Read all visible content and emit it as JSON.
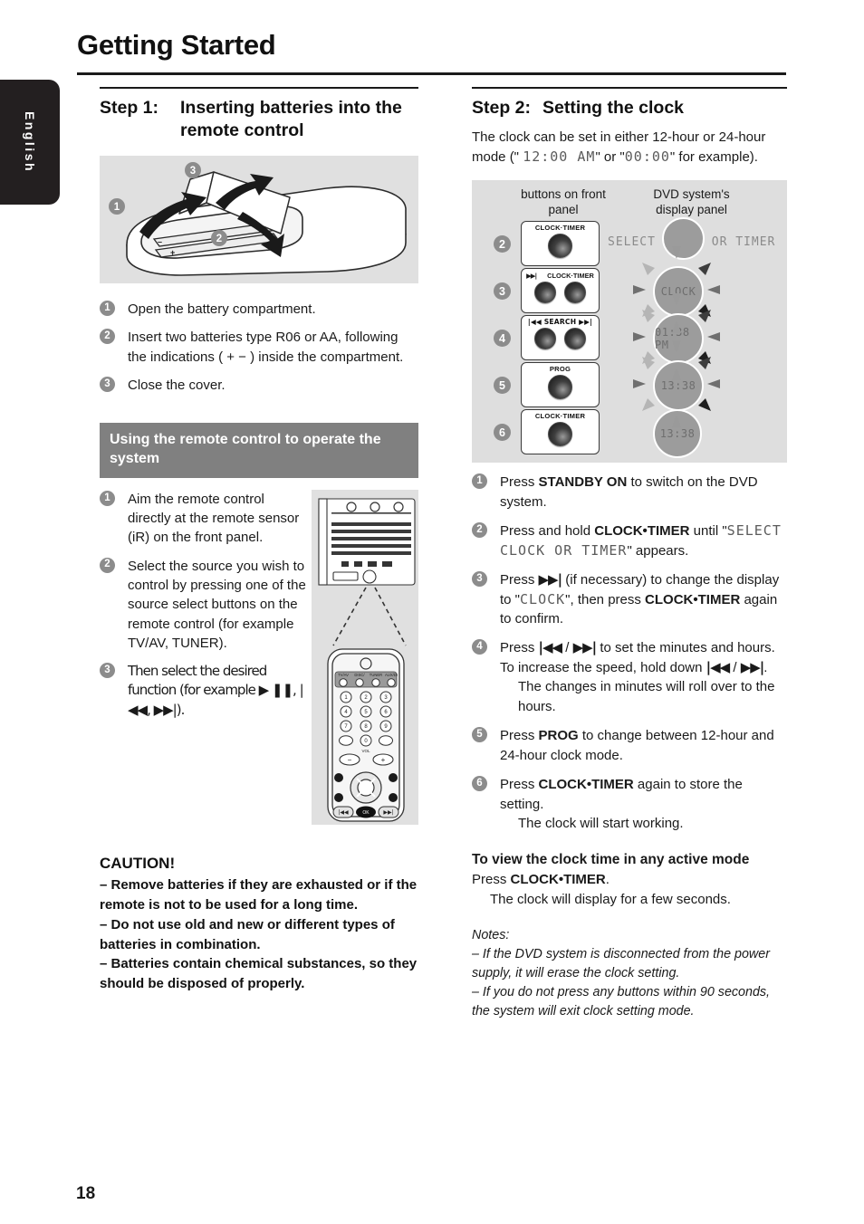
{
  "page": {
    "title": "Getting Started",
    "language_tab": "English",
    "page_number": "18"
  },
  "left": {
    "step": {
      "label": "Step 1:",
      "title": "Inserting batteries into the remote control"
    },
    "illustration": {
      "name": "remote-control-battery-compartment",
      "callouts": [
        "1",
        "2",
        "3"
      ],
      "polarity_marks": [
        "+",
        "-",
        "+",
        "-"
      ]
    },
    "items": [
      {
        "num": "1",
        "text": "Open the battery compartment."
      },
      {
        "num": "2",
        "text": "Insert two batteries type R06 or AA, following the indications ( + − ) inside the compartment."
      },
      {
        "num": "3",
        "text": "Close the cover."
      }
    ],
    "section_bar": "Using the remote control to operate the system",
    "use_items": [
      {
        "num": "1",
        "text": "Aim the remote control directly at the remote sensor (iR) on the front panel."
      },
      {
        "num": "2",
        "text": "Select the source you wish to control by pressing one of the source select buttons on the remote control (for example TV/AV, TUNER)."
      },
      {
        "num": "3",
        "text": "Then select the desired function (for example ▶ ❚❚, |◀◀, ▶▶|)."
      }
    ],
    "remote_art": {
      "name": "front-panel-and-remote-control",
      "source_buttons": [
        "TV/AV",
        "DISC/MEDIA",
        "TUNER",
        "AUX/DI"
      ],
      "keypad": [
        "1",
        "2",
        "3",
        "4",
        "5",
        "6",
        "7",
        "8",
        "9",
        "0"
      ],
      "vol_label": "VOL",
      "ok_label": "OK"
    },
    "caution": {
      "heading": "CAUTION!",
      "lines": [
        "–  Remove batteries if they are exhausted or if the remote is not to be used for a long time.",
        "–  Do not use old and new or different types of batteries in combination.",
        "–  Batteries contain chemical substances, so they should be disposed of properly."
      ]
    }
  },
  "right": {
    "step": {
      "label": "Step 2:",
      "title": "Setting the clock"
    },
    "intro": {
      "part1": "The clock can be set in either 12-hour or 24-hour mode (\" ",
      "lcd1": "12:00 AM",
      "part2": "\" or \"",
      "lcd2": "00:00",
      "part3": "\" for example)."
    },
    "diagram": {
      "caption_left": "buttons on front panel",
      "caption_right": "DVD system's display panel",
      "rows": [
        {
          "num": "2",
          "buttons": [
            "CLOCK·TIMER"
          ],
          "display": "SELECT CLOCK OR TIMER"
        },
        {
          "num": "3",
          "buttons": [
            "▶▶|",
            "CLOCK·TIMER"
          ],
          "display": "CLOCK"
        },
        {
          "num": "4",
          "buttons": [
            "|◀◀ SEARCH ▶▶|"
          ],
          "display": "01:38 PM"
        },
        {
          "num": "5",
          "buttons": [
            "PROG"
          ],
          "display": "13:38"
        },
        {
          "num": "6",
          "buttons": [
            "CLOCK·TIMER"
          ],
          "display": "13:38"
        }
      ]
    },
    "steps": [
      {
        "num": "1",
        "html": "Press <b>STANDBY ON</b> to switch on the DVD system."
      },
      {
        "num": "2",
        "html": "Press and hold <b>CLOCK•TIMER</b> until \"<span class='lcd'>SELECT CLOCK OR TIMER</span>\" appears."
      },
      {
        "num": "3",
        "html": "Press <b class='glyph'>▶▶|</b> (if necessary) to change the display to \"<span class='lcd'>CLOCK</span>\", then press <b>CLOCK•TIMER</b> again to confirm."
      },
      {
        "num": "4",
        "html": "Press <b class='glyph'>|◀◀</b> / <b class='glyph'>▶▶|</b> to set the minutes and hours. To increase the speed, hold down <b class='glyph'>|◀◀</b> / <b class='glyph'>▶▶|</b>.<span class='sub'>The changes in minutes will roll over to the hours.</span>"
      },
      {
        "num": "5",
        "html": "Press <b>PROG</b> to change between 12-hour and 24-hour clock mode."
      },
      {
        "num": "6",
        "html": "Press <b>CLOCK•TIMER</b> again to store the setting.<span class='sub'>The clock will start working.</span>"
      }
    ],
    "view_mode": {
      "heading": "To view the clock time in any active mode",
      "body_html": "Press <b>CLOCK•TIMER</b>.<span class='sub'>The clock will display for a few seconds.</span>"
    },
    "notes": {
      "label": "Notes:",
      "items": [
        "–  If the DVD system is disconnected from the power supply, it will erase the clock setting.",
        "–  If you do not press any buttons within 90 seconds, the system will exit clock setting mode."
      ]
    }
  },
  "colors": {
    "tab_black": "#231f20",
    "section_bar_grey": "#808080",
    "illustration_grey": "#e0e0e0",
    "diagram_grey": "#dedede",
    "badge_grey": "#8c8c8c",
    "lcd_grey": "#8a8a8a"
  }
}
